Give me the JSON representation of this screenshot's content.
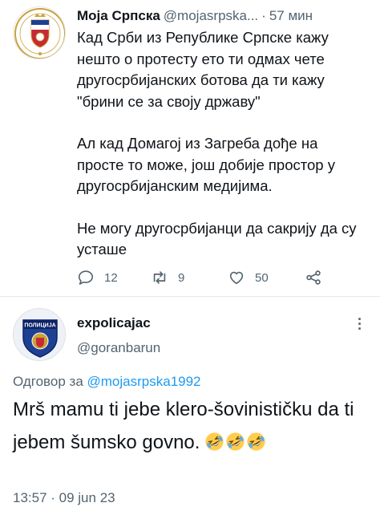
{
  "tweet1": {
    "display_name": "Моја Српска",
    "handle": "@mojasrpska...",
    "separator": "·",
    "time": "57 мин",
    "paragraphs": [
      "Кад Срби из Републике Српске кажу нешто о протесту ето ти одмах чете другосрбијанских ботова да ти кажу \"брини се за своју државу\"",
      "Ал кад Домагој из Загреба дође на просте то може, још добије простор у другосрбијанским медијима.",
      "Не могу другосрбијанци да сакрију да су усташе"
    ],
    "actions": {
      "reply_count": "12",
      "retweet_count": "9",
      "like_count": "50"
    },
    "icons": [
      "coat-of-arms-avatar",
      "reply-icon",
      "retweet-icon",
      "like-icon",
      "share-icon"
    ],
    "accent_color": "#536471"
  },
  "tweet2": {
    "display_name": "expolicajac",
    "handle": "@goranbarun",
    "avatar_badge_text": "ПОЛИЦИЈА",
    "reply_prefix": "Одговор за",
    "reply_target": "@mojasrpska1992",
    "text": "Mrš mamu ti jebe klero-šovinističku da ti jebem šumsko govno.",
    "emojis": [
      "rolling-on-floor-laughing",
      "rolling-on-floor-laughing",
      "rolling-on-floor-laughing"
    ],
    "timestamp": "13:57 · 09 jun 23",
    "link_color": "#1d9bf0"
  }
}
